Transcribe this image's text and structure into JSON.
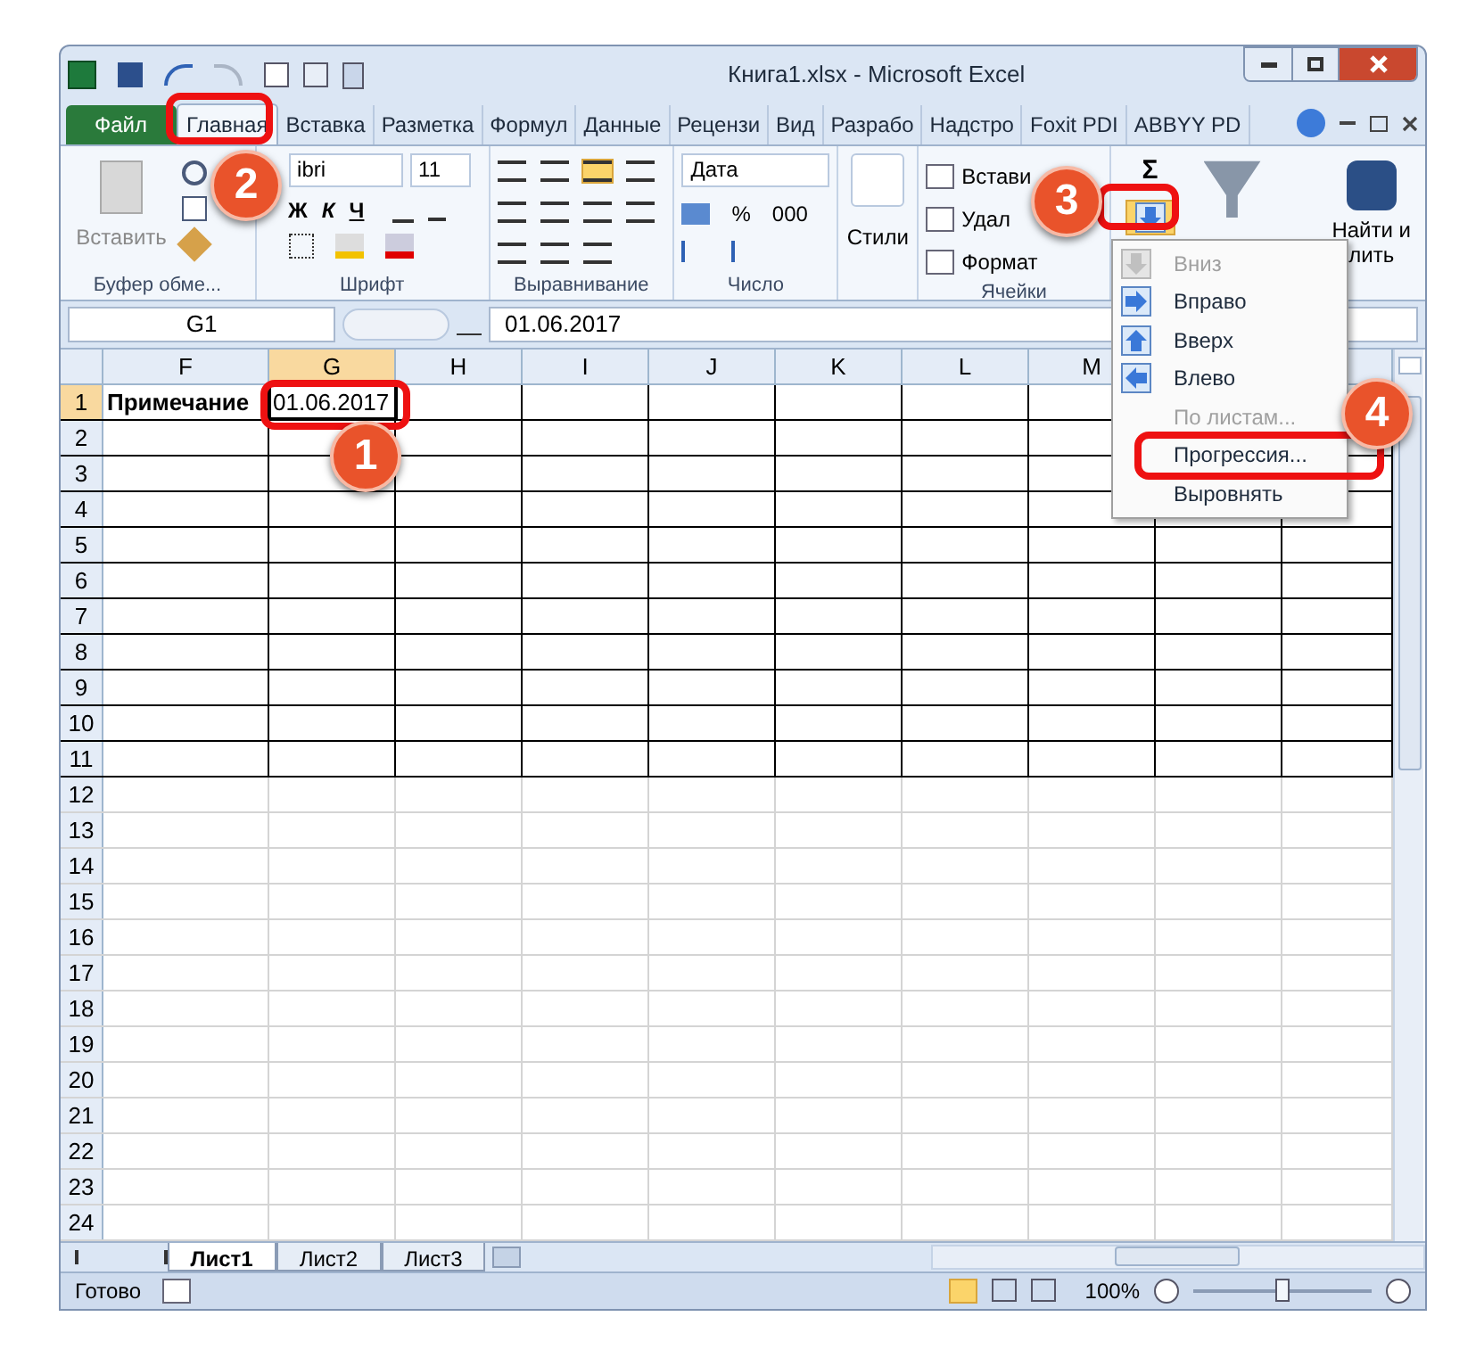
{
  "window": {
    "title": "Книга1.xlsx - Microsoft Excel"
  },
  "ribbon_tabs": [
    {
      "label": "Файл",
      "kind": "file",
      "selected": false
    },
    {
      "label": "Главная",
      "kind": "tab",
      "selected": true
    },
    {
      "label": "Вставка",
      "kind": "tab",
      "selected": false
    },
    {
      "label": "Разметка",
      "kind": "tab",
      "selected": false
    },
    {
      "label": "Формул",
      "kind": "tab",
      "selected": false
    },
    {
      "label": "Данные",
      "kind": "tab",
      "selected": false
    },
    {
      "label": "Рецензи",
      "kind": "tab",
      "selected": false
    },
    {
      "label": "Вид",
      "kind": "tab",
      "selected": false
    },
    {
      "label": "Разрабо",
      "kind": "tab",
      "selected": false
    },
    {
      "label": "Надстро",
      "kind": "tab",
      "selected": false
    },
    {
      "label": "Foxit PDI",
      "kind": "tab",
      "selected": false
    },
    {
      "label": "ABBYY PD",
      "kind": "tab",
      "selected": false
    }
  ],
  "clipboard": {
    "paste": "Вставить",
    "label": "Буфер обме..."
  },
  "font": {
    "name": "ibri",
    "size": "11",
    "bold": "Ж",
    "italic": "К",
    "underline": "Ч",
    "label": "Шрифт"
  },
  "alignment": {
    "label": "Выравнивание"
  },
  "number": {
    "format": "Дата",
    "percent": "%",
    "thousands": "000",
    "label": "Число"
  },
  "styles": {
    "label": "Стили"
  },
  "cells": {
    "insert": "Встави",
    "delete": "Удал",
    "format": "Формат",
    "label": "Ячейки"
  },
  "editing": {
    "sum": "Σ",
    "find_line1": "Найти и",
    "find_line2": "лить"
  },
  "name_box": "G1",
  "formula": "01.06.2017",
  "columns": [
    "F",
    "G",
    "H",
    "I",
    "J",
    "K",
    "L",
    "M"
  ],
  "rows": [
    "1",
    "2",
    "3",
    "4",
    "5",
    "6",
    "7",
    "8",
    "9",
    "10",
    "11",
    "12",
    "13",
    "14",
    "15",
    "16",
    "17",
    "18",
    "19",
    "20",
    "21",
    "22",
    "23",
    "24"
  ],
  "cells_row1": [
    {
      "text": "Примечание",
      "bold": true,
      "selected": false
    },
    {
      "text": "01.06.2017",
      "bold": false,
      "selected": true
    }
  ],
  "fill_menu": [
    {
      "label": "Вниз",
      "disabled": true
    },
    {
      "label": "Вправо",
      "disabled": false
    },
    {
      "label": "Вверх",
      "disabled": false
    },
    {
      "label": "Влево",
      "disabled": false
    },
    {
      "label": "По листам...",
      "disabled": true
    },
    {
      "label": "Прогрессия...",
      "disabled": false
    },
    {
      "label": "Выровнять",
      "disabled": false
    }
  ],
  "callouts": [
    "1",
    "2",
    "3",
    "4"
  ],
  "sheet_tabs": [
    {
      "label": "Лист1",
      "selected": true
    },
    {
      "label": "Лист2",
      "selected": false
    },
    {
      "label": "Лист3",
      "selected": false
    }
  ],
  "status_bar": {
    "text": "Готово",
    "zoom": "100%",
    "zoom_level": {
      "level": 0.5
    }
  }
}
